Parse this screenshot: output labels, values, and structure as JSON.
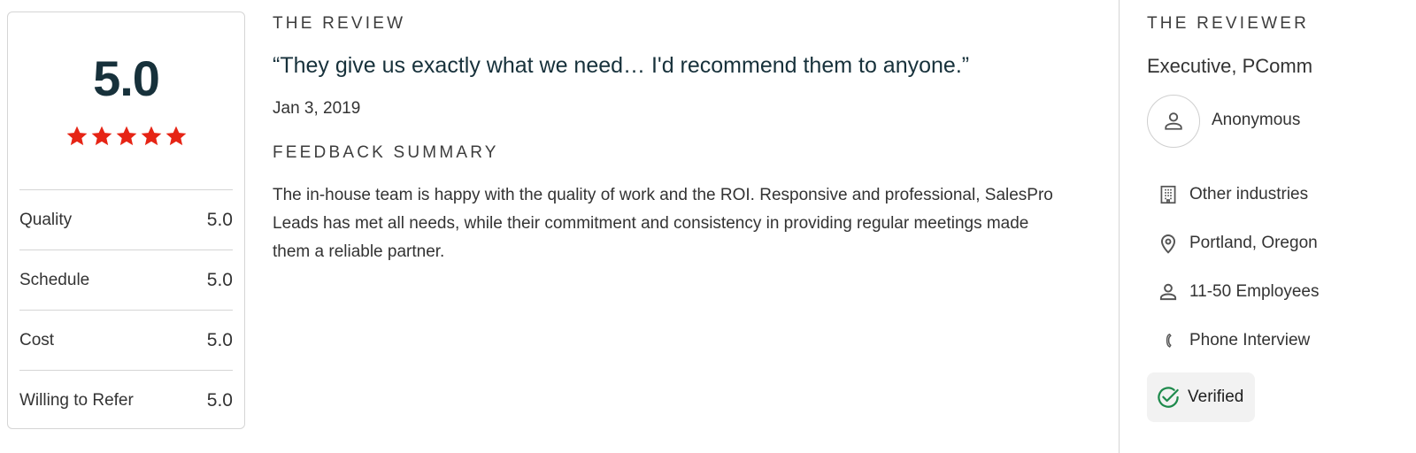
{
  "rating": {
    "overall": "5.0",
    "stars": 5,
    "star_color": "#e62415",
    "scores": [
      {
        "label": "Quality",
        "value": "5.0"
      },
      {
        "label": "Schedule",
        "value": "5.0"
      },
      {
        "label": "Cost",
        "value": "5.0"
      },
      {
        "label": "Willing to Refer",
        "value": "5.0"
      }
    ]
  },
  "review": {
    "heading": "THE REVIEW",
    "quote": "“They give us exactly what we need… I'd recommend them to anyone.”",
    "date": "Jan 3, 2019",
    "summary_heading": "FEEDBACK SUMMARY",
    "summary": "The in-house team is happy with the quality of work and the ROI. Responsive and professional, SalesPro Leads has met all needs, while their commitment and consistency in providing regular meetings made them a reliable partner."
  },
  "reviewer": {
    "heading": "THE REVIEWER",
    "position": "Executive, PComm",
    "name": "Anonymous",
    "details": [
      {
        "icon": "building-icon",
        "text": "Other industries"
      },
      {
        "icon": "location-pin-icon",
        "text": "Portland, Oregon"
      },
      {
        "icon": "person-icon",
        "text": "11-50 Employees"
      },
      {
        "icon": "phone-icon",
        "text": "Phone Interview"
      }
    ],
    "verified": "Verified",
    "verified_color": "#1e8a4c"
  }
}
